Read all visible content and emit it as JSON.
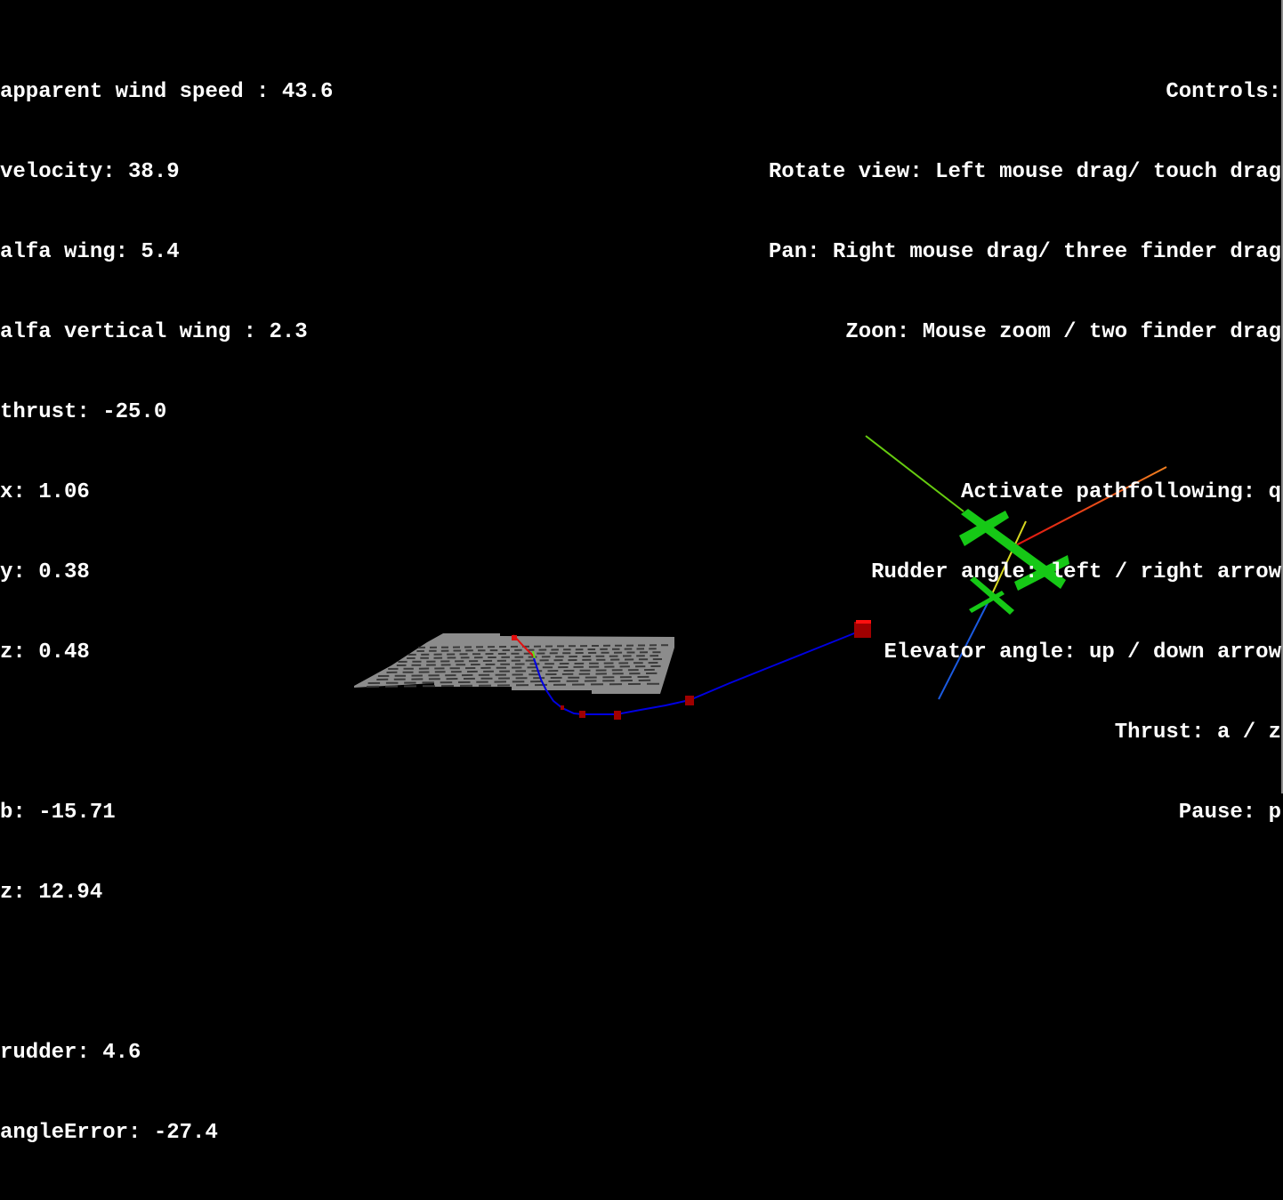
{
  "telemetry": {
    "apparent_wind_speed": "apparent wind speed : 43.6",
    "velocity": "velocity: 38.9",
    "alfa_wing": "alfa wing: 5.4",
    "alfa_vertical_wing": "alfa vertical wing : 2.3",
    "thrust": "thrust: -25.0",
    "x": "x: 1.06",
    "y": "y: 0.38",
    "z": "z: 0.48",
    "b": "b: -15.71",
    "z2": "z: 12.94",
    "rudder": "rudder: 4.6",
    "angle_error": "angleError: -27.4"
  },
  "controls": {
    "title": "Controls:",
    "rotate": "Rotate view: Left mouse drag/ touch drag",
    "pan": "Pan: Right mouse drag/ three finder drag",
    "zoom": "Zoon: Mouse zoom / two finder drag",
    "pathfollowing": "Activate pathfollowing: q",
    "rudder": "Rudder angle: left / right arrow",
    "elevator": "Elevator angle: up / down arrow",
    "thrust": "Thrust: a / z",
    "pause": "Pause: p"
  },
  "scene": {
    "colors": {
      "background": "#000000",
      "ground_plate": "#8c8c8c",
      "ground_dash": "#3a3a3a",
      "path": "#0000e0",
      "waypoint": "#a00000",
      "waypoint_top": "#ff1010",
      "aircraft": "#16c816",
      "axis_x": "#e03010",
      "axis_y": "#d8d820",
      "axis_z": "#1a5ae0",
      "wind_vector": "#66cc10"
    },
    "waypoint_count": 6
  }
}
